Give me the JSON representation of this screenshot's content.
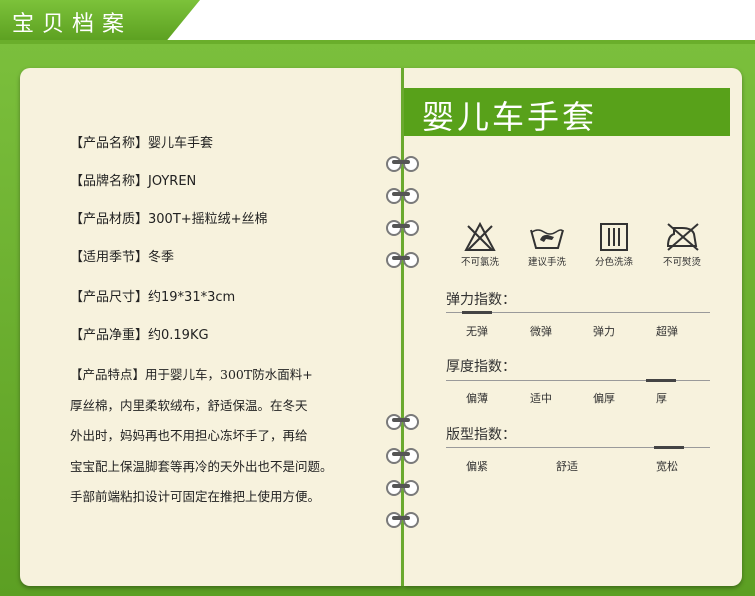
{
  "header": {
    "title": "宝贝档案"
  },
  "info": {
    "name": "【产品名称】婴儿车手套",
    "brand": "【品牌名称】JOYREN",
    "material": "【产品材质】300T+摇粒绒+丝棉",
    "season": "【适用季节】冬季",
    "size": "【产品尺寸】约19*31*3cm",
    "weight": "【产品净重】约0.19KG",
    "features": [
      "【产品特点】用于婴儿车，300T防水面料+",
      "厚丝棉，内里柔软绒布，舒适保温。在冬天",
      "外出时，妈妈再也不用担心冻坏手了，再给",
      "宝宝配上保温脚套等再冷的天外出也不是问题。",
      "手部前端粘扣设计可固定在推把上使用方便。"
    ]
  },
  "product_title": "婴儿车手套",
  "care": [
    {
      "label": "不可氯洗",
      "icon": "no-bleach-icon"
    },
    {
      "label": "建议手洗",
      "icon": "hand-wash-icon"
    },
    {
      "label": "分色洗涤",
      "icon": "separate-wash-icon"
    },
    {
      "label": "不可熨烫",
      "icon": "no-iron-icon"
    }
  ],
  "indices": {
    "elasticity": {
      "title": "弹力指数：",
      "options": [
        "无弹",
        "微弹",
        "弹力",
        "超弹"
      ],
      "selected": "无弹"
    },
    "thickness": {
      "title": "厚度指数：",
      "options": [
        "偏薄",
        "适中",
        "偏厚",
        "厚"
      ],
      "selected": "厚"
    },
    "fit": {
      "title": "版型指数：",
      "options": [
        "偏紧",
        "舒适",
        "宽松"
      ],
      "selected": "宽松"
    }
  },
  "colors": {
    "accent": "#58a11a",
    "page": "#f7f2dd",
    "backdrop": "#6aae2b"
  }
}
